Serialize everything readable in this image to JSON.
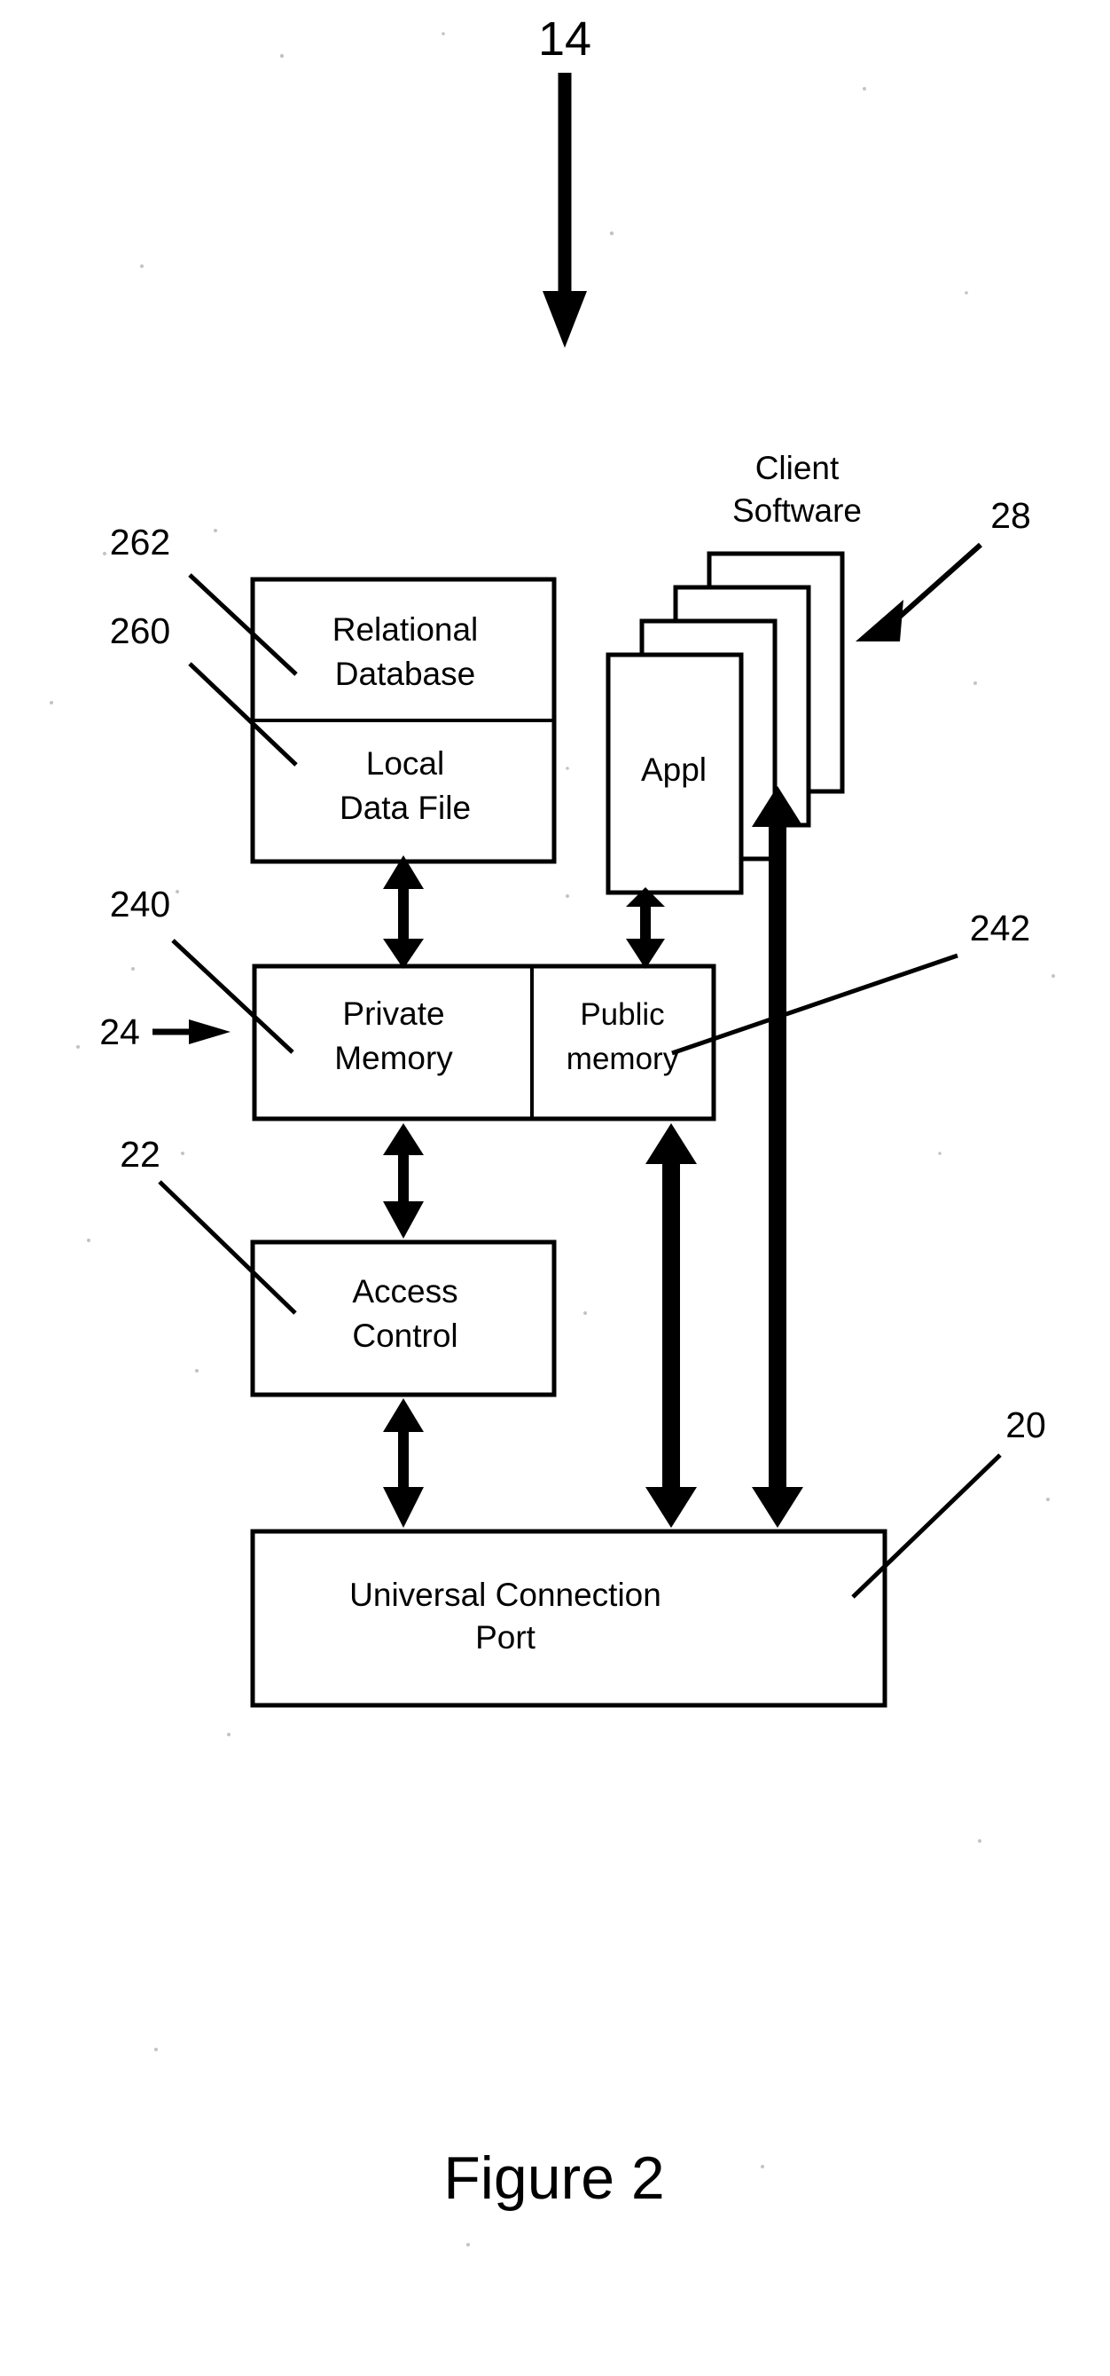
{
  "figure": {
    "caption": "Figure 2",
    "top_reference": "14"
  },
  "reference_numerals": {
    "top_system": "14",
    "relational_database": "262",
    "local_data_file": "260",
    "private_memory": "240",
    "memory_block": "24",
    "public_memory": "242",
    "access_control": "22",
    "client_software": "28",
    "universal_connection_port": "20"
  },
  "blocks": {
    "relational_database": {
      "line1": "Relational",
      "line2": "Database"
    },
    "local_data_file": {
      "line1": "Local",
      "line2": "Data File"
    },
    "private_memory": {
      "line1": "Private",
      "line2": "Memory"
    },
    "public_memory": {
      "line1": "Public",
      "line2": "memory"
    },
    "access_control": {
      "line1": "Access",
      "line2": "Control"
    },
    "universal_connection_port": {
      "line1": "Universal Connection",
      "line2": "Port"
    },
    "application": {
      "label": "Appl"
    }
  },
  "client_software": {
    "title_line1": "Client",
    "title_line2": "Software",
    "stack_count": 4
  },
  "colors": {
    "ink": "#000000",
    "page": "#ffffff"
  },
  "connections": [
    {
      "name": "db-to-private-memory",
      "style": "double-headed-vertical"
    },
    {
      "name": "appl-to-public-memory",
      "style": "double-headed-vertical"
    },
    {
      "name": "private-memory-to-access-control",
      "style": "double-headed-vertical"
    },
    {
      "name": "access-control-to-port",
      "style": "double-headed-vertical"
    },
    {
      "name": "public-memory-to-port",
      "style": "double-headed-vertical-thick"
    },
    {
      "name": "client-software-to-port",
      "style": "double-headed-vertical-thick"
    }
  ]
}
